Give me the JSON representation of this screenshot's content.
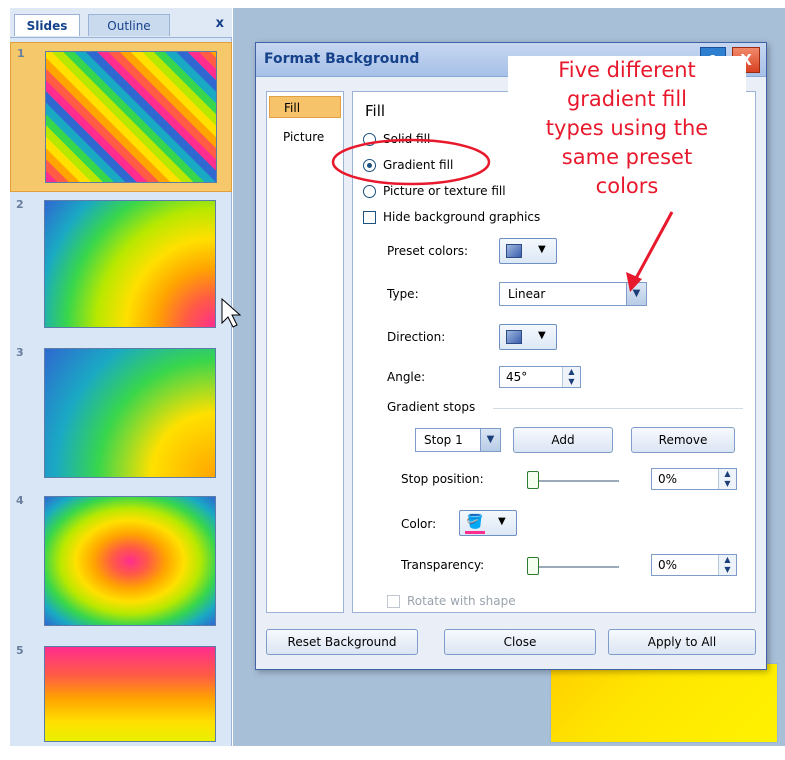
{
  "slides_pane": {
    "tabs": [
      "Slides",
      "Outline"
    ],
    "close_label": "x",
    "slide_numbers": [
      "1",
      "2",
      "3",
      "4",
      "5"
    ]
  },
  "dialog": {
    "title": "Format Background",
    "help_label": "?",
    "close_label": "X",
    "nav": [
      "Fill",
      "Picture"
    ],
    "section_title": "Fill",
    "options": {
      "solid_fill": "Solid fill",
      "gradient_fill": "Gradient fill",
      "picture_fill": "Picture or texture fill",
      "hide_graphics": "Hide background graphics"
    },
    "preset_colors_label": "Preset colors:",
    "type_label": "Type:",
    "type_value": "Linear",
    "direction_label": "Direction:",
    "angle_label": "Angle:",
    "angle_value": "45°",
    "gradient_stops_label": "Gradient stops",
    "stop_value": "Stop 1",
    "add_label": "Add",
    "remove_label": "Remove",
    "stop_position_label": "Stop position:",
    "stop_position_value": "0%",
    "color_label": "Color:",
    "transparency_label": "Transparency:",
    "transparency_value": "0%",
    "rotate_label": "Rotate with shape",
    "buttons": {
      "reset": "Reset Background",
      "close": "Close",
      "apply_all": "Apply to All"
    }
  },
  "annotation": {
    "lines": [
      "Five different",
      "gradient fill",
      "types using the",
      "same preset",
      "colors"
    ],
    "color": "#e8192c"
  }
}
